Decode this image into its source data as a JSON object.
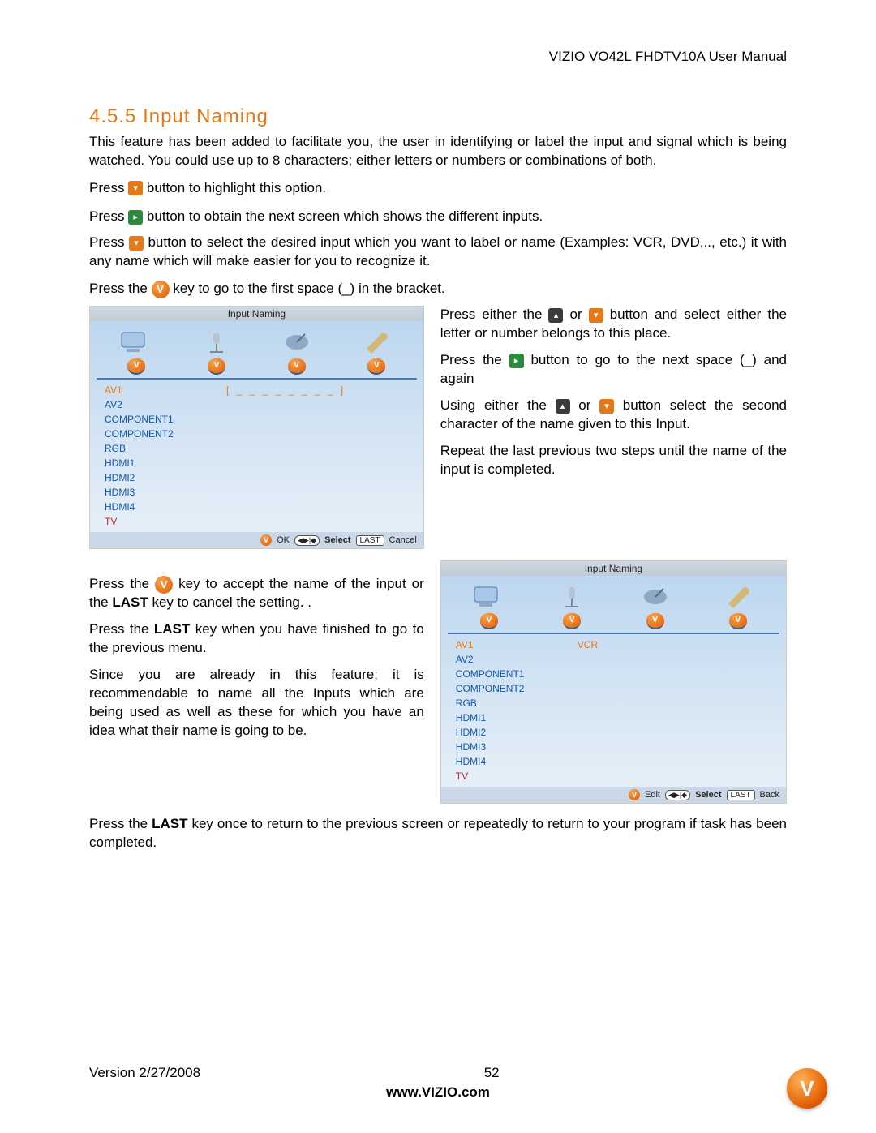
{
  "header": {
    "doc_title": "VIZIO VO42L FHDTV10A User Manual"
  },
  "section": {
    "number": "4.5.5",
    "title": "Input Naming",
    "intro": "This feature has been added to facilitate you, the user in identifying or label the input and signal which is being watched. You could use up to 8 characters; either letters or numbers or combinations of both."
  },
  "steps": {
    "s1a": "Press ",
    "s1b": " button to highlight this option.",
    "s2a": "Press ",
    "s2b": " button to obtain the next screen which shows the different inputs.",
    "s3a": "Press ",
    "s3b": " button to select the desired input which you want to label or name (Examples: VCR, DVD,.., etc.) it with any name which will make easier for you to recognize it.",
    "s4a": "Press the ",
    "s4b": " key to go to the first space (_) in the bracket."
  },
  "right1": {
    "p1a": "Press either the ",
    "p1b": " or ",
    "p1c": " button and select either the letter or number belongs to this place.",
    "p2a": "Press the ",
    "p2b": " button to go to the next space (_) and again",
    "p3a": "Using either the ",
    "p3b": " or ",
    "p3c": " button select the second character of the name given to this Input.",
    "p4": "Repeat the last previous two steps until the name of the input is completed."
  },
  "left2": {
    "p1a": "Press the ",
    "p1b": " key to accept the name of the input or the ",
    "p1c": " key to cancel the setting. .",
    "p1_last": "LAST",
    "p2a": "Press the ",
    "p2_last": "LAST",
    "p2b": " key when you have finished to go to the previous menu.",
    "p3": "Since you are already in this feature; it is recommendable to name all the Inputs which are being used as well as these for which you have an idea what their name is going to be."
  },
  "bottom": {
    "p1a": "Press the ",
    "p1_last": "LAST",
    "p1b": " key once to return to the previous screen or repeatedly to return to your program if task has been completed."
  },
  "menu": {
    "title": "Input Naming",
    "items": [
      "AV1",
      "AV2",
      "COMPONENT1",
      "COMPONENT2",
      "RGB",
      "HDMI1",
      "HDMI2",
      "HDMI3",
      "HDMI4",
      "TV"
    ],
    "edit_value": "[ _ _ _ _ _ _ _ _ ]",
    "value2": "VCR",
    "footer1": {
      "ok": "OK",
      "select": "Select",
      "last": "LAST",
      "cancel": "Cancel",
      "arrows": "◀▶|◆"
    },
    "footer2": {
      "edit": "Edit",
      "select": "Select",
      "last": "LAST",
      "back": "Back",
      "arrows": "◀▶|◆"
    }
  },
  "footer": {
    "version": "Version 2/27/2008",
    "page": "52",
    "url": "www.VIZIO.com"
  },
  "icons": {
    "v": "V",
    "down": "▾",
    "right": "▸",
    "up": "▴"
  }
}
